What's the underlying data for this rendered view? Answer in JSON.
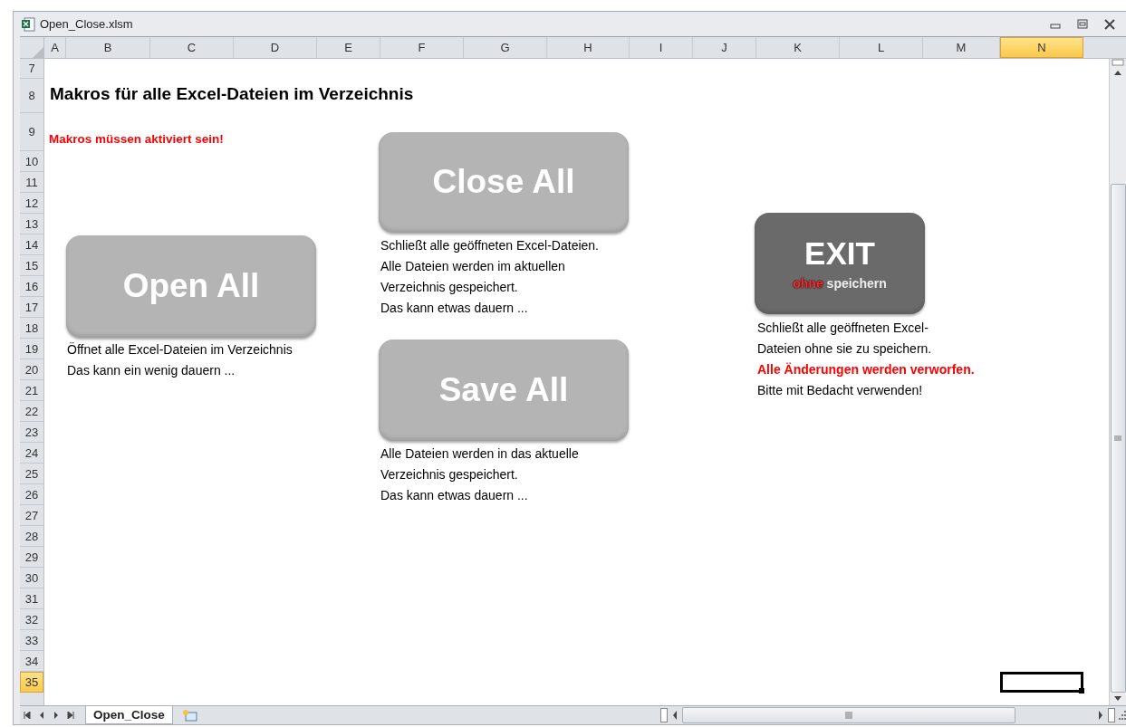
{
  "window": {
    "title": "Open_Close.xlsm"
  },
  "columns": [
    {
      "label": "A",
      "selected": false
    },
    {
      "label": "B",
      "selected": false
    },
    {
      "label": "C",
      "selected": false
    },
    {
      "label": "D",
      "selected": false
    },
    {
      "label": "E",
      "selected": false
    },
    {
      "label": "F",
      "selected": false
    },
    {
      "label": "G",
      "selected": false
    },
    {
      "label": "H",
      "selected": false
    },
    {
      "label": "I",
      "selected": false
    },
    {
      "label": "J",
      "selected": false
    },
    {
      "label": "K",
      "selected": false
    },
    {
      "label": "L",
      "selected": false
    },
    {
      "label": "M",
      "selected": false
    },
    {
      "label": "N",
      "selected": true
    }
  ],
  "rows": [
    {
      "label": "7",
      "selected": false
    },
    {
      "label": "8",
      "selected": false
    },
    {
      "label": "9",
      "selected": false
    },
    {
      "label": "10",
      "selected": false
    },
    {
      "label": "11",
      "selected": false
    },
    {
      "label": "12",
      "selected": false
    },
    {
      "label": "13",
      "selected": false
    },
    {
      "label": "14",
      "selected": false
    },
    {
      "label": "15",
      "selected": false
    },
    {
      "label": "16",
      "selected": false
    },
    {
      "label": "17",
      "selected": false
    },
    {
      "label": "18",
      "selected": false
    },
    {
      "label": "19",
      "selected": false
    },
    {
      "label": "20",
      "selected": false
    },
    {
      "label": "21",
      "selected": false
    },
    {
      "label": "22",
      "selected": false
    },
    {
      "label": "23",
      "selected": false
    },
    {
      "label": "24",
      "selected": false
    },
    {
      "label": "25",
      "selected": false
    },
    {
      "label": "26",
      "selected": false
    },
    {
      "label": "27",
      "selected": false
    },
    {
      "label": "28",
      "selected": false
    },
    {
      "label": "29",
      "selected": false
    },
    {
      "label": "30",
      "selected": false
    },
    {
      "label": "31",
      "selected": false
    },
    {
      "label": "32",
      "selected": false
    },
    {
      "label": "33",
      "selected": false
    },
    {
      "label": "34",
      "selected": false
    },
    {
      "label": "35",
      "selected": true
    }
  ],
  "sheet": {
    "heading": "Makros für alle Excel-Dateien im Verzeichnis",
    "warning": "Makros müssen aktiviert sein!",
    "buttons": [
      {
        "kind": "light",
        "label": "Open All"
      },
      {
        "kind": "light",
        "label": "Close All"
      },
      {
        "kind": "light",
        "label": "Save All"
      },
      {
        "kind": "dark",
        "label": "EXIT",
        "subtitle_highlight": "ohne",
        "subtitle": "speichern"
      }
    ],
    "notes": [
      {
        "lines": [
          {
            "text": "Öffnet alle Excel-Dateien im Verzeichnis",
            "kind": "normal"
          },
          {
            "text": "Das kann ein wenig dauern ...",
            "kind": "normal"
          }
        ]
      },
      {
        "lines": [
          {
            "text": "Schließt alle geöffneten Excel-Dateien.",
            "kind": "normal"
          },
          {
            "text": "Alle Dateien werden im aktuellen",
            "kind": "normal"
          },
          {
            "text": "Verzeichnis gespeichert.",
            "kind": "normal"
          },
          {
            "text": "Das kann etwas dauern ...",
            "kind": "normal"
          }
        ]
      },
      {
        "lines": [
          {
            "text": "Alle Dateien werden in das aktuelle",
            "kind": "normal"
          },
          {
            "text": "Verzeichnis gespeichert.",
            "kind": "normal"
          },
          {
            "text": "Das kann etwas dauern ...",
            "kind": "normal"
          }
        ]
      },
      {
        "lines": [
          {
            "text": "Schließt alle geöffneten Excel-",
            "kind": "normal"
          },
          {
            "text": "Dateien ohne sie zu speichern.",
            "kind": "normal"
          },
          {
            "text": "Alle Änderungen werden verworfen.",
            "kind": "warning"
          },
          {
            "text": "Bitte mit Bedacht verwenden!",
            "kind": "normal"
          }
        ]
      }
    ]
  },
  "sheet_tabs": [
    {
      "label": "Open_Close",
      "selected": true
    }
  ]
}
